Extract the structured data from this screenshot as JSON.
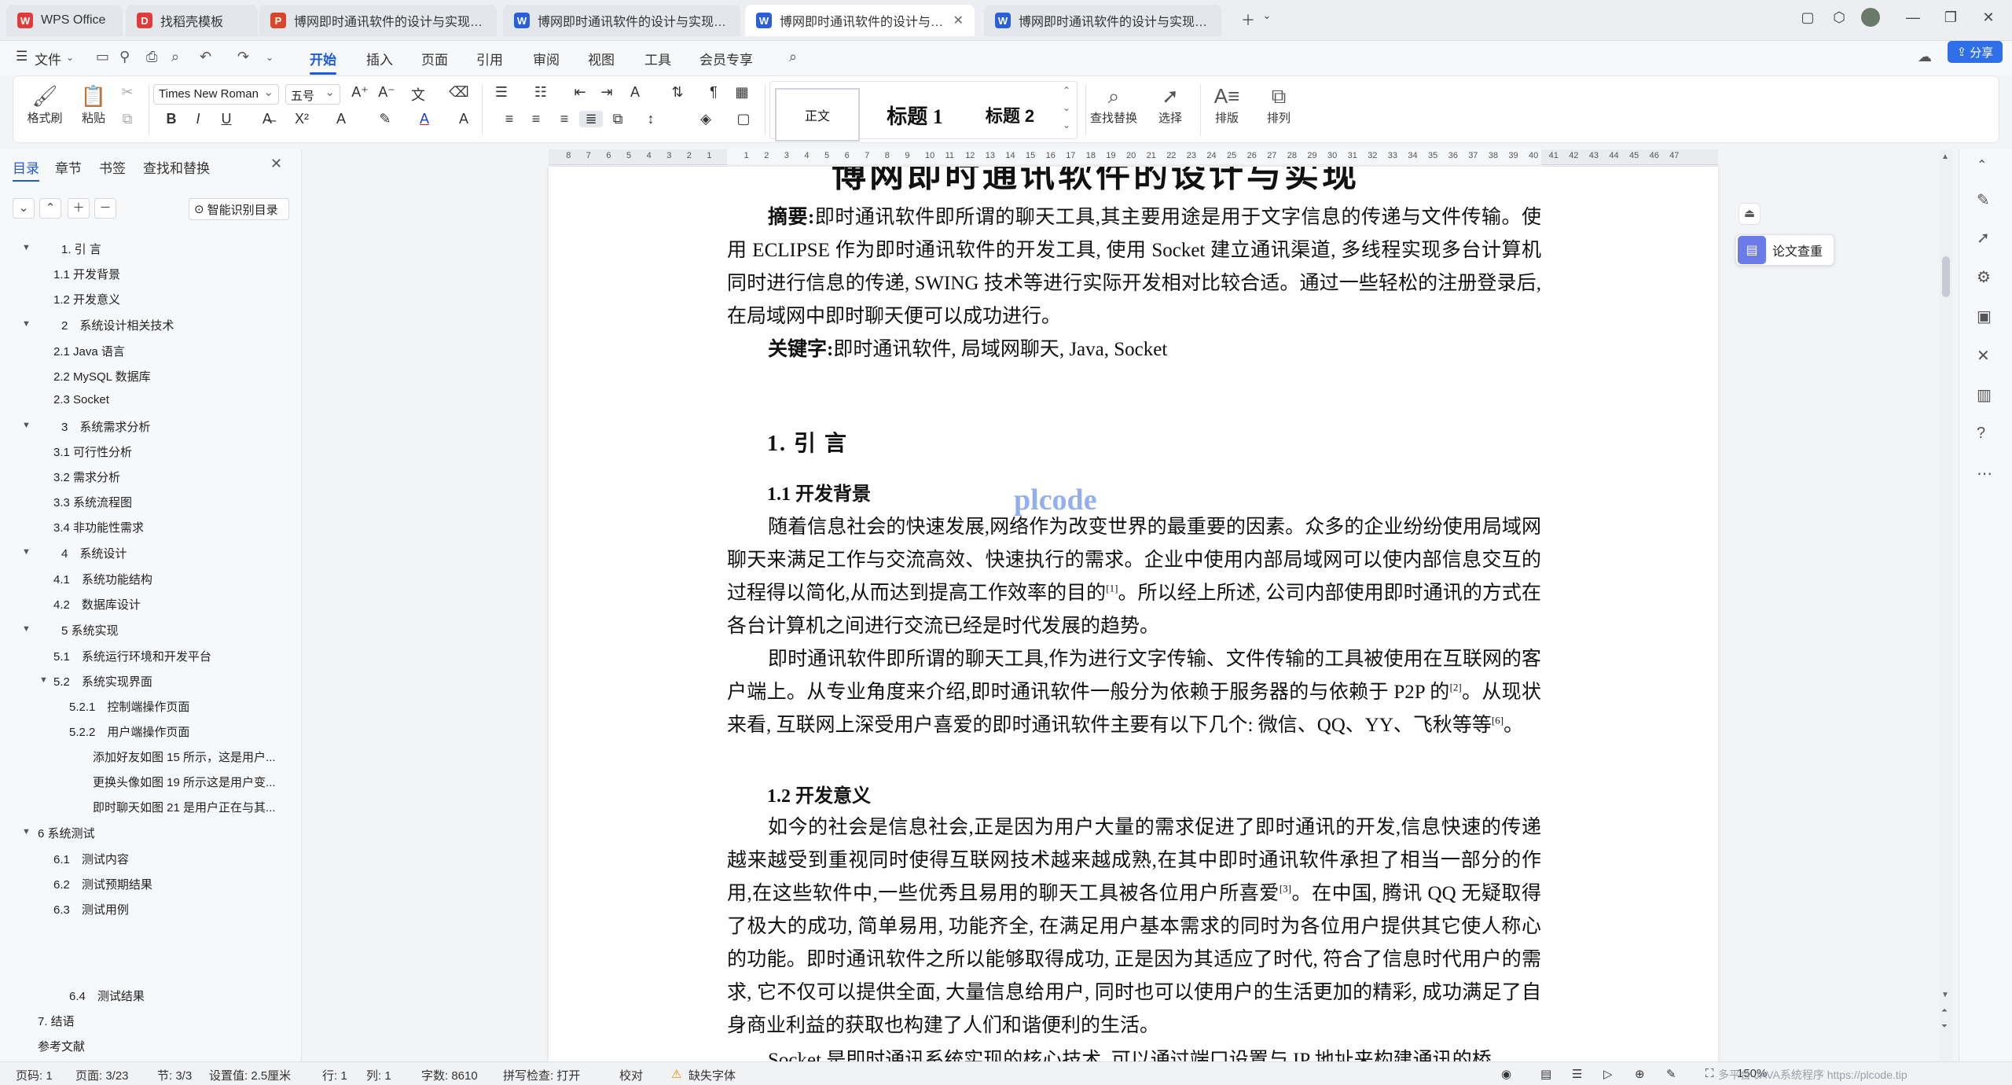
{
  "tabs": [
    {
      "label": "WPS Office",
      "icon": "W",
      "color": "#e23b3b",
      "active": false
    },
    {
      "label": "找稻壳模板",
      "icon": "D",
      "color": "#e23b3b",
      "active": false
    },
    {
      "label": "博网即时通讯软件的设计与实现毕业论文",
      "icon": "P",
      "color": "#d9472b",
      "active": false
    },
    {
      "label": "博网即时通讯软件的设计与实现毕业论文",
      "icon": "W",
      "color": "#2b5fd9",
      "active": false
    },
    {
      "label": "博网即时通讯软件的设计与实现毕业论文",
      "icon": "W",
      "color": "#2b5fd9",
      "active": true
    },
    {
      "label": "博网即时通讯软件的设计与实现毕业论文",
      "icon": "W",
      "color": "#2b5fd9",
      "active": false
    }
  ],
  "menu": {
    "file": "文件",
    "items": [
      "开始",
      "插入",
      "页面",
      "引用",
      "审阅",
      "视图",
      "工具",
      "会员专享"
    ],
    "share": "分享"
  },
  "ribbon": {
    "format_painter": "格式刷",
    "paste": "粘贴",
    "font_name": "Times New Roman",
    "font_size": "五号",
    "styles": {
      "normal": "正文",
      "h1": "标题 1",
      "h2": "标题 2"
    },
    "find_replace": "查找替换",
    "select": "选择",
    "layout": "排版",
    "arrange": "排列"
  },
  "nav": {
    "tabs": [
      "目录",
      "章节",
      "书签",
      "查找和替换"
    ],
    "smart_toc": "智能识别目录",
    "toc": [
      {
        "text": "1. 引 言",
        "level": 1,
        "caret": true
      },
      {
        "text": "1.1 开发背景",
        "level": 2,
        "caret": false
      },
      {
        "text": "1.2 开发意义",
        "level": 2,
        "caret": false
      },
      {
        "text": "2　系统设计相关技术",
        "level": 1,
        "caret": true
      },
      {
        "text": "2.1 Java 语言",
        "level": 2,
        "caret": false
      },
      {
        "text": "2.2 MySQL 数据库",
        "level": 2,
        "caret": false
      },
      {
        "text": "2.3 Socket",
        "level": 2,
        "caret": false
      },
      {
        "text": "3　系统需求分析",
        "level": 1,
        "caret": true
      },
      {
        "text": "3.1 可行性分析",
        "level": 2,
        "caret": false
      },
      {
        "text": "3.2 需求分析",
        "level": 2,
        "caret": false
      },
      {
        "text": "3.3 系统流程图",
        "level": 2,
        "caret": false
      },
      {
        "text": "3.4 非功能性需求",
        "level": 2,
        "caret": false
      },
      {
        "text": "4　系统设计",
        "level": 1,
        "caret": true
      },
      {
        "text": "4.1　系统功能结构",
        "level": 2,
        "caret": false
      },
      {
        "text": "4.2　数据库设计",
        "level": 2,
        "caret": false
      },
      {
        "text": "5 系统实现",
        "level": 1,
        "caret": true
      },
      {
        "text": "5.1　系统运行环境和开发平台",
        "level": 2,
        "caret": false
      },
      {
        "text": "5.2　系统实现界面",
        "level": 2,
        "caret": true
      },
      {
        "text": "5.2.1　控制端操作页面",
        "level": 3,
        "caret": false
      },
      {
        "text": "5.2.2　用户端操作页面",
        "level": 3,
        "caret": false
      },
      {
        "text": "添加好友如图 15 所示，这是用户...",
        "level": 4,
        "caret": false
      },
      {
        "text": "更换头像如图 19 所示这是用户变...",
        "level": 4,
        "caret": false
      },
      {
        "text": "即时聊天如图 21 是用户正在与其...",
        "level": 4,
        "caret": false
      },
      {
        "text": "6 系统测试",
        "level": 0,
        "caret": true
      },
      {
        "text": "6.1　测试内容",
        "level": 2,
        "caret": false
      },
      {
        "text": "6.2　测试预期结果",
        "level": 2,
        "caret": false
      },
      {
        "text": "6.3　测试用例",
        "level": 2,
        "caret": false
      },
      {
        "text": "6.4　测试结果",
        "level": 3,
        "caret": false
      },
      {
        "text": "7. 结语",
        "level": 0,
        "caret": false
      },
      {
        "text": "参考文献",
        "level": 0,
        "caret": false
      }
    ]
  },
  "ruler": {
    "left_ticks": [
      "8",
      "7",
      "6",
      "5",
      "4",
      "3",
      "2",
      "1"
    ],
    "right_ticks": [
      "1",
      "2",
      "3",
      "4",
      "5",
      "6",
      "7",
      "8",
      "9",
      "10",
      "11",
      "12",
      "13",
      "14",
      "15",
      "16",
      "17",
      "18",
      "19",
      "20",
      "21",
      "22",
      "23",
      "24",
      "25",
      "26",
      "27",
      "28",
      "29",
      "30",
      "31",
      "32",
      "33",
      "34",
      "35",
      "36",
      "37",
      "38",
      "39",
      "40",
      "41",
      "42",
      "43",
      "44",
      "45",
      "46",
      "47"
    ]
  },
  "doc": {
    "title_partial": "博网即时通讯软件的设计与实现",
    "abstract_label": "摘要:",
    "abstract": "即时通讯软件即所谓的聊天工具,其主要用途是用于文字信息的传递与文件传输。使用 ECLIPSE 作为即时通讯软件的开发工具, 使用 Socket 建立通讯渠道, 多线程实现多台计算机同时进行信息的传递, SWING 技术等进行实际开发相对比较合适。通过一些轻松的注册登录后, 在局域网中即时聊天便可以成功进行。",
    "keywords_label": "关键字:",
    "keywords": "即时通讯软件, 局域网聊天, Java, Socket",
    "h1": "1. 引 言",
    "h11": "1.1 开发背景",
    "p1": "随着信息社会的快速发展,网络作为改变世界的最重要的因素。众多的企业纷纷使用局域网聊天来满足工作与交流高效、快速执行的需求。企业中使用内部局域网可以使内部信息交互的过程得以简化,从而达到提高工作效率的目的",
    "p1_ref": "[1]",
    "p1_tail": "。所以经上所述, 公司内部使用即时通讯的方式在各台计算机之间进行交流已经是时代发展的趋势。",
    "p2": "即时通讯软件即所谓的聊天工具,作为进行文字传输、文件传输的工具被使用在互联网的客户端上。从专业角度来介绍,即时通讯软件一般分为依赖于服务器的与依赖于 P2P 的",
    "p2_ref": "[2]",
    "p2_mid": "。从现状来看, 互联网上深受用户喜爱的即时通讯软件主要有以下几个: 微信、QQ、YY、飞秋等等",
    "p2_ref2": "[6]",
    "p2_tail": "。",
    "h12": "1.2 开发意义",
    "p3": "如今的社会是信息社会,正是因为用户大量的需求促进了即时通讯的开发,信息快速的传递越来越受到重视同时使得互联网技术越来越成熟,在其中即时通讯软件承担了相当一部分的作用,在这些软件中,一些优秀且易用的聊天工具被各位用户所喜爱",
    "p3_ref": "[3]",
    "p3_tail": "。在中国, 腾讯 QQ 无疑取得了极大的成功, 简单易用, 功能齐全, 在满足用户基本需求的同时为各位用户提供其它使人称心的功能。即时通讯软件之所以能够取得成功, 正是因为其适应了时代, 符合了信息时代用户的需求, 它不仅可以提供全面, 大量信息给用户, 同时也可以使用户的生活更加的精彩, 成功满足了自身商业利益的获取也构建了人们和谐便利的生活。",
    "p4_partial": "Socket 是即时通讯系统实现的核心技术, 可以通过端口设置与 IP 地址来构建通讯的桥",
    "watermark": "plcode"
  },
  "side": {
    "lunwen": "论文查重"
  },
  "status": {
    "pagecode": "页码: 1",
    "page": "页面: 3/23",
    "section": "节: 3/3",
    "setting": "设置值: 2.5厘米",
    "row": "行: 1",
    "col": "列: 1",
    "wordcount": "字数: 8610",
    "spellcheck": "拼写检查: 打开",
    "proof": "校对",
    "missing_font": "缺失字体",
    "zoom": "150%",
    "footer_wm": "多平台 JAVA系统程序 https://plcode.tip"
  }
}
